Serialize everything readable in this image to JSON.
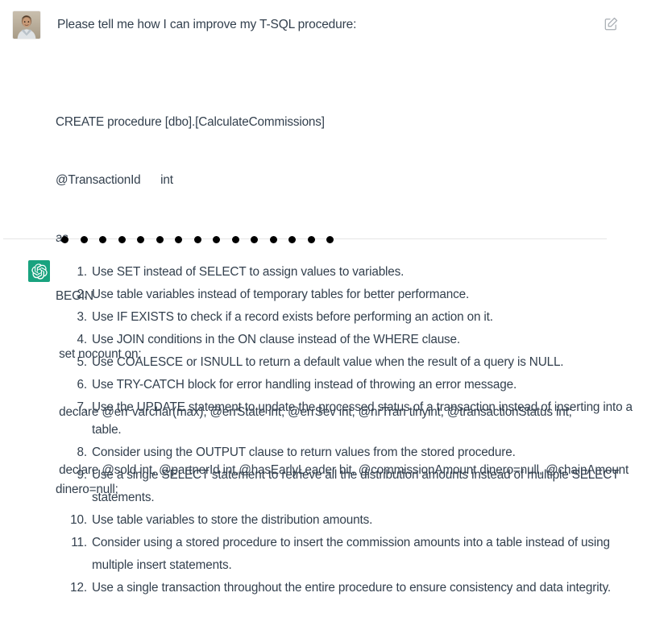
{
  "user_message": {
    "avatar_alt": "user-photo-avatar",
    "prompt": "Please tell me how I can improve my T-SQL procedure:",
    "edit_icon": "edit-square-pencil-icon",
    "code_lines": [
      "CREATE procedure [dbo].[CalculateCommissions]",
      "@TransactionId      int",
      "as",
      "BEGIN",
      " set nocount on;",
      " declare @err varchar(max), @errState int, @errSev int, @nrTran tinyint, @transactionStatus int;",
      " declare @sold int, @partnerId int,@hasEarlyLeader bit, @commissionAmount dinero=null, @chainAmount dinero=null;"
    ]
  },
  "divider": {
    "dot_count": 15,
    "dot_color": "#000000",
    "rule_color": "#e6e6e6"
  },
  "assistant_message": {
    "avatar_icon": "chatgpt-logo-icon",
    "avatar_color": "#19a37f",
    "items": [
      "Use SET instead of SELECT to assign values to variables.",
      "Use table variables instead of temporary tables for better performance.",
      "Use IF EXISTS to check if a record exists before performing an action on it.",
      "Use JOIN conditions in the ON clause instead of the WHERE clause.",
      "Use COALESCE or ISNULL to return a default value when the result of a query is NULL.",
      "Use TRY-CATCH block for error handling instead of throwing an error message.",
      "Use the UPDATE statement to update the processed status of a transaction instead of inserting into a table.",
      "Consider using the OUTPUT clause to return values from the stored procedure.",
      "Use a single SELECT statement to retrieve all the distribution amounts instead of multiple SELECT statements.",
      "Use table variables to store the distribution amounts.",
      "Consider using a stored procedure to insert the commission amounts into a table instead of using multiple insert statements.",
      "Use a single transaction throughout the entire procedure to ensure consistency and data integrity."
    ]
  },
  "theme": {
    "text_color": "#33404e",
    "background": "#ffffff",
    "brand_green": "#19a37f"
  }
}
